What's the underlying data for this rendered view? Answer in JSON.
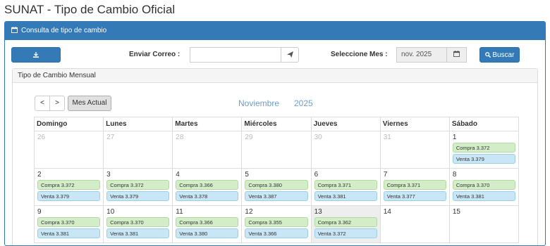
{
  "page": {
    "title": "SUNAT - Tipo de Cambio Oficial"
  },
  "panel": {
    "heading": "Consulta de tipo de cambio"
  },
  "toolbar": {
    "download_label": "Descargar",
    "email_label": "Enviar Correo :",
    "email_value": "",
    "month_label": "Seleccione Mes :",
    "month_value": "nov. 2025",
    "search_label": "Buscar"
  },
  "subpanel": {
    "heading": "Tipo de Cambio Mensual"
  },
  "calendar": {
    "prev_label": "<",
    "next_label": ">",
    "today_label": "Mes Actual",
    "month_name": "Noviembre",
    "year": "2025",
    "weekdays": [
      "Domingo",
      "Lunes",
      "Martes",
      "Miércoles",
      "Jueves",
      "Viernes",
      "Sábado"
    ],
    "weeks": [
      [
        {
          "day": "26",
          "other": true
        },
        {
          "day": "27",
          "other": true
        },
        {
          "day": "28",
          "other": true
        },
        {
          "day": "29",
          "other": true
        },
        {
          "day": "30",
          "other": true
        },
        {
          "day": "31",
          "other": true
        },
        {
          "day": "1",
          "compra": "Compra 3.372",
          "venta": "Venta 3.379"
        }
      ],
      [
        {
          "day": "2",
          "compra": "Compra 3.372",
          "venta": "Venta 3.379"
        },
        {
          "day": "3",
          "compra": "Compra 3.372",
          "venta": "Venta 3.379"
        },
        {
          "day": "4",
          "compra": "Compra 3.366",
          "venta": "Venta 3.378"
        },
        {
          "day": "5",
          "compra": "Compra 3.380",
          "venta": "Venta 3.387"
        },
        {
          "day": "6",
          "compra": "Compra 3.371",
          "venta": "Venta 3.381"
        },
        {
          "day": "7",
          "compra": "Compra 3.371",
          "venta": "Venta 3.377"
        },
        {
          "day": "8",
          "compra": "Compra 3.370",
          "venta": "Venta 3.381"
        }
      ],
      [
        {
          "day": "9",
          "compra": "Compra 3.370",
          "venta": "Venta 3.381"
        },
        {
          "day": "10",
          "compra": "Compra 3.370",
          "venta": "Venta 3.381"
        },
        {
          "day": "11",
          "compra": "Compra 3.366",
          "venta": "Venta 3.380"
        },
        {
          "day": "12",
          "compra": "Compra 3.355",
          "venta": "Venta 3.366"
        },
        {
          "day": "13",
          "compra": "Compra 3.362",
          "venta": "Venta 3.372",
          "today": true
        },
        {
          "day": "14"
        },
        {
          "day": "15"
        }
      ]
    ]
  },
  "colors": {
    "primary": "#337ab7",
    "compra_bg": "#d4edc9",
    "venta_bg": "#c8e6f5",
    "month_title": "#6d9ec8"
  },
  "icons": {
    "heading": "calendar-icon",
    "download": "download-icon",
    "send": "paper-plane-icon",
    "month": "calendar-icon",
    "search": "search-icon"
  }
}
